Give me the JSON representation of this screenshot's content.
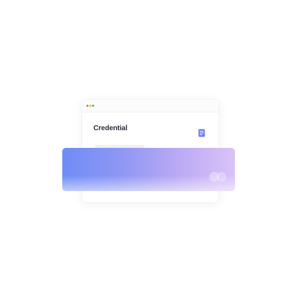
{
  "window": {
    "controls": [
      "close",
      "minimize",
      "maximize"
    ],
    "colors": {
      "close": "#f2645b",
      "minimize": "#f5b73a",
      "maximize": "#47c05a"
    }
  },
  "card": {
    "title": "Credential",
    "icon": "document-icon",
    "accent": "#6c7cf0"
  },
  "gradient_card": {
    "gradient_start": "#6f8cf6",
    "gradient_end": "#dbc3f8",
    "brand_icon": "card-brand-icon"
  }
}
